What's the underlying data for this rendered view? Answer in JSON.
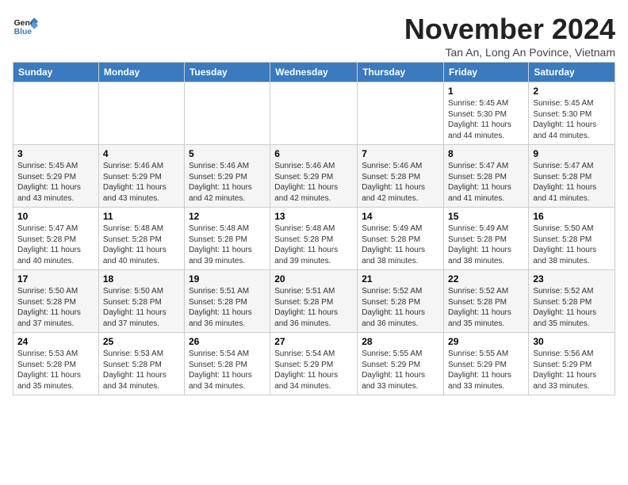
{
  "logo": {
    "line1": "General",
    "line2": "Blue"
  },
  "title": "November 2024",
  "subtitle": "Tan An, Long An Povince, Vietnam",
  "weekdays": [
    "Sunday",
    "Monday",
    "Tuesday",
    "Wednesday",
    "Thursday",
    "Friday",
    "Saturday"
  ],
  "weeks": [
    [
      {
        "day": "",
        "info": ""
      },
      {
        "day": "",
        "info": ""
      },
      {
        "day": "",
        "info": ""
      },
      {
        "day": "",
        "info": ""
      },
      {
        "day": "",
        "info": ""
      },
      {
        "day": "1",
        "info": "Sunrise: 5:45 AM\nSunset: 5:30 PM\nDaylight: 11 hours\nand 44 minutes."
      },
      {
        "day": "2",
        "info": "Sunrise: 5:45 AM\nSunset: 5:30 PM\nDaylight: 11 hours\nand 44 minutes."
      }
    ],
    [
      {
        "day": "3",
        "info": "Sunrise: 5:45 AM\nSunset: 5:29 PM\nDaylight: 11 hours\nand 43 minutes."
      },
      {
        "day": "4",
        "info": "Sunrise: 5:46 AM\nSunset: 5:29 PM\nDaylight: 11 hours\nand 43 minutes."
      },
      {
        "day": "5",
        "info": "Sunrise: 5:46 AM\nSunset: 5:29 PM\nDaylight: 11 hours\nand 42 minutes."
      },
      {
        "day": "6",
        "info": "Sunrise: 5:46 AM\nSunset: 5:29 PM\nDaylight: 11 hours\nand 42 minutes."
      },
      {
        "day": "7",
        "info": "Sunrise: 5:46 AM\nSunset: 5:28 PM\nDaylight: 11 hours\nand 42 minutes."
      },
      {
        "day": "8",
        "info": "Sunrise: 5:47 AM\nSunset: 5:28 PM\nDaylight: 11 hours\nand 41 minutes."
      },
      {
        "day": "9",
        "info": "Sunrise: 5:47 AM\nSunset: 5:28 PM\nDaylight: 11 hours\nand 41 minutes."
      }
    ],
    [
      {
        "day": "10",
        "info": "Sunrise: 5:47 AM\nSunset: 5:28 PM\nDaylight: 11 hours\nand 40 minutes."
      },
      {
        "day": "11",
        "info": "Sunrise: 5:48 AM\nSunset: 5:28 PM\nDaylight: 11 hours\nand 40 minutes."
      },
      {
        "day": "12",
        "info": "Sunrise: 5:48 AM\nSunset: 5:28 PM\nDaylight: 11 hours\nand 39 minutes."
      },
      {
        "day": "13",
        "info": "Sunrise: 5:48 AM\nSunset: 5:28 PM\nDaylight: 11 hours\nand 39 minutes."
      },
      {
        "day": "14",
        "info": "Sunrise: 5:49 AM\nSunset: 5:28 PM\nDaylight: 11 hours\nand 38 minutes."
      },
      {
        "day": "15",
        "info": "Sunrise: 5:49 AM\nSunset: 5:28 PM\nDaylight: 11 hours\nand 38 minutes."
      },
      {
        "day": "16",
        "info": "Sunrise: 5:50 AM\nSunset: 5:28 PM\nDaylight: 11 hours\nand 38 minutes."
      }
    ],
    [
      {
        "day": "17",
        "info": "Sunrise: 5:50 AM\nSunset: 5:28 PM\nDaylight: 11 hours\nand 37 minutes."
      },
      {
        "day": "18",
        "info": "Sunrise: 5:50 AM\nSunset: 5:28 PM\nDaylight: 11 hours\nand 37 minutes."
      },
      {
        "day": "19",
        "info": "Sunrise: 5:51 AM\nSunset: 5:28 PM\nDaylight: 11 hours\nand 36 minutes."
      },
      {
        "day": "20",
        "info": "Sunrise: 5:51 AM\nSunset: 5:28 PM\nDaylight: 11 hours\nand 36 minutes."
      },
      {
        "day": "21",
        "info": "Sunrise: 5:52 AM\nSunset: 5:28 PM\nDaylight: 11 hours\nand 36 minutes."
      },
      {
        "day": "22",
        "info": "Sunrise: 5:52 AM\nSunset: 5:28 PM\nDaylight: 11 hours\nand 35 minutes."
      },
      {
        "day": "23",
        "info": "Sunrise: 5:52 AM\nSunset: 5:28 PM\nDaylight: 11 hours\nand 35 minutes."
      }
    ],
    [
      {
        "day": "24",
        "info": "Sunrise: 5:53 AM\nSunset: 5:28 PM\nDaylight: 11 hours\nand 35 minutes."
      },
      {
        "day": "25",
        "info": "Sunrise: 5:53 AM\nSunset: 5:28 PM\nDaylight: 11 hours\nand 34 minutes."
      },
      {
        "day": "26",
        "info": "Sunrise: 5:54 AM\nSunset: 5:28 PM\nDaylight: 11 hours\nand 34 minutes."
      },
      {
        "day": "27",
        "info": "Sunrise: 5:54 AM\nSunset: 5:29 PM\nDaylight: 11 hours\nand 34 minutes."
      },
      {
        "day": "28",
        "info": "Sunrise: 5:55 AM\nSunset: 5:29 PM\nDaylight: 11 hours\nand 33 minutes."
      },
      {
        "day": "29",
        "info": "Sunrise: 5:55 AM\nSunset: 5:29 PM\nDaylight: 11 hours\nand 33 minutes."
      },
      {
        "day": "30",
        "info": "Sunrise: 5:56 AM\nSunset: 5:29 PM\nDaylight: 11 hours\nand 33 minutes."
      }
    ]
  ]
}
